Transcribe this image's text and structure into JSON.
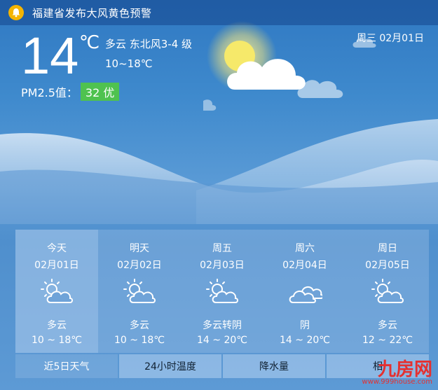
{
  "alert": {
    "icon": "bell-icon",
    "text": "福建省发布大风黄色预警"
  },
  "current": {
    "temperature": "14",
    "unit": "℃",
    "condition": "多云 东北风3-4 级",
    "range": "10~18℃",
    "pm_label": "PM2.5值：",
    "pm_value": "32 优",
    "pm_color": "#4fc24f",
    "date": "周三 02月01日",
    "icon": "sun-cloud-icon"
  },
  "forecast": [
    {
      "day": "今天",
      "date": "02月01日",
      "icon": "partly-cloudy-icon",
      "condition": "多云",
      "temp": "10 ~ 18℃",
      "active": true
    },
    {
      "day": "明天",
      "date": "02月02日",
      "icon": "partly-cloudy-icon",
      "condition": "多云",
      "temp": "10 ~ 18℃"
    },
    {
      "day": "周五",
      "date": "02月03日",
      "icon": "partly-cloudy-icon",
      "condition": "多云转阴",
      "temp": "14 ~ 20℃"
    },
    {
      "day": "周六",
      "date": "02月04日",
      "icon": "cloudy-icon",
      "condition": "阴",
      "temp": "14 ~ 20℃"
    },
    {
      "day": "周日",
      "date": "02月05日",
      "icon": "partly-cloudy-icon",
      "condition": "多云",
      "temp": "12 ~ 22℃"
    }
  ],
  "tabs": [
    "近5日天气",
    "24小时温度",
    "降水量",
    "相"
  ],
  "watermark": {
    "logo": "九房网",
    "url": "www.999house.com"
  }
}
